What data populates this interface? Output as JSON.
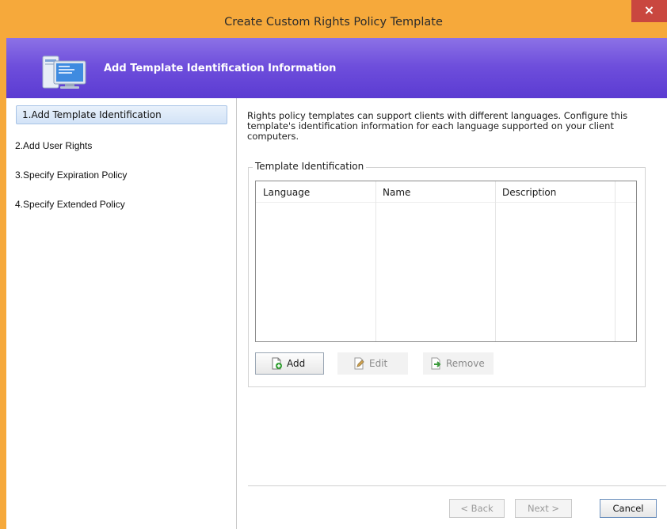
{
  "window": {
    "title": "Create Custom Rights Policy Template",
    "close_label": "×"
  },
  "banner": {
    "title": "Add Template Identification Information",
    "icon": "computer-icon"
  },
  "steps": [
    {
      "label": "1.Add Template Identification",
      "active": true
    },
    {
      "label": "2.Add User Rights",
      "active": false
    },
    {
      "label": "3.Specify Expiration Policy",
      "active": false
    },
    {
      "label": "4.Specify Extended Policy",
      "active": false
    }
  ],
  "main": {
    "intro": "Rights policy templates can support clients with different languages. Configure this template's identification information for each language supported on your client computers.",
    "group_label": "Template Identification",
    "columns": [
      "Language",
      "Name",
      "Description"
    ],
    "buttons": {
      "add": "Add",
      "edit": "Edit",
      "remove": "Remove"
    }
  },
  "footer": {
    "back": "< Back",
    "next": "Next >",
    "cancel": "Cancel"
  },
  "colors": {
    "frame": "#f6a93b",
    "banner": "#6f4fdc",
    "close": "#c9473f"
  }
}
